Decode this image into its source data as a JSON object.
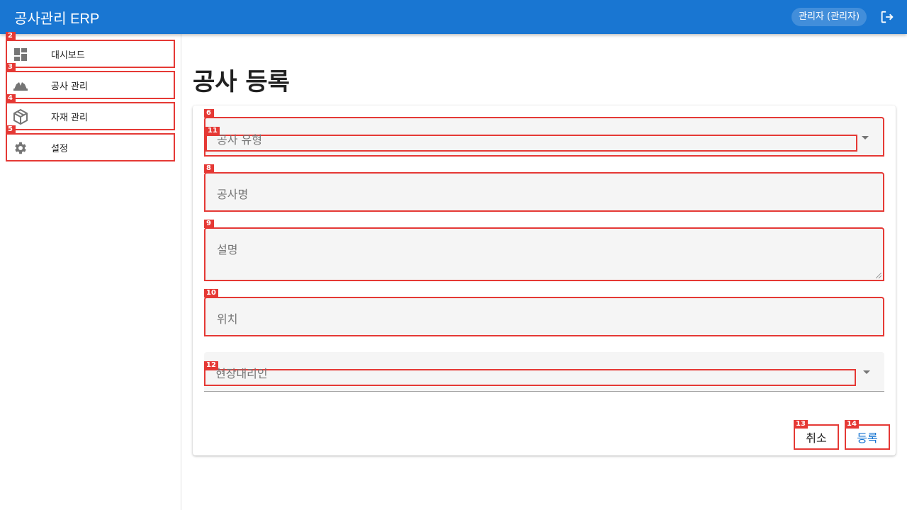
{
  "header": {
    "title": "공사관리 ERP",
    "user_label": "관리자 (관리자)"
  },
  "sidebar": {
    "items": [
      {
        "label": "대시보드",
        "icon": "dashboard-icon"
      },
      {
        "label": "공사 관리",
        "icon": "construction-icon"
      },
      {
        "label": "자재 관리",
        "icon": "package-icon"
      },
      {
        "label": "설정",
        "icon": "gear-icon"
      }
    ]
  },
  "page": {
    "title": "공사 등록"
  },
  "form": {
    "type_label": "공사 유형",
    "name_label": "공사명",
    "description_label": "설명",
    "location_label": "위치",
    "manager_label": "현장대리인",
    "cancel_label": "취소",
    "submit_label": "등록"
  },
  "badges": {
    "b2": "2",
    "b3": "3",
    "b4": "4",
    "b5": "5",
    "b6": "6",
    "b8": "8",
    "b9": "9",
    "b10": "10",
    "b11": "11",
    "b12": "12",
    "b13": "13",
    "b14": "14"
  },
  "colors": {
    "primary": "#1976d2",
    "highlight": "#e53935"
  }
}
